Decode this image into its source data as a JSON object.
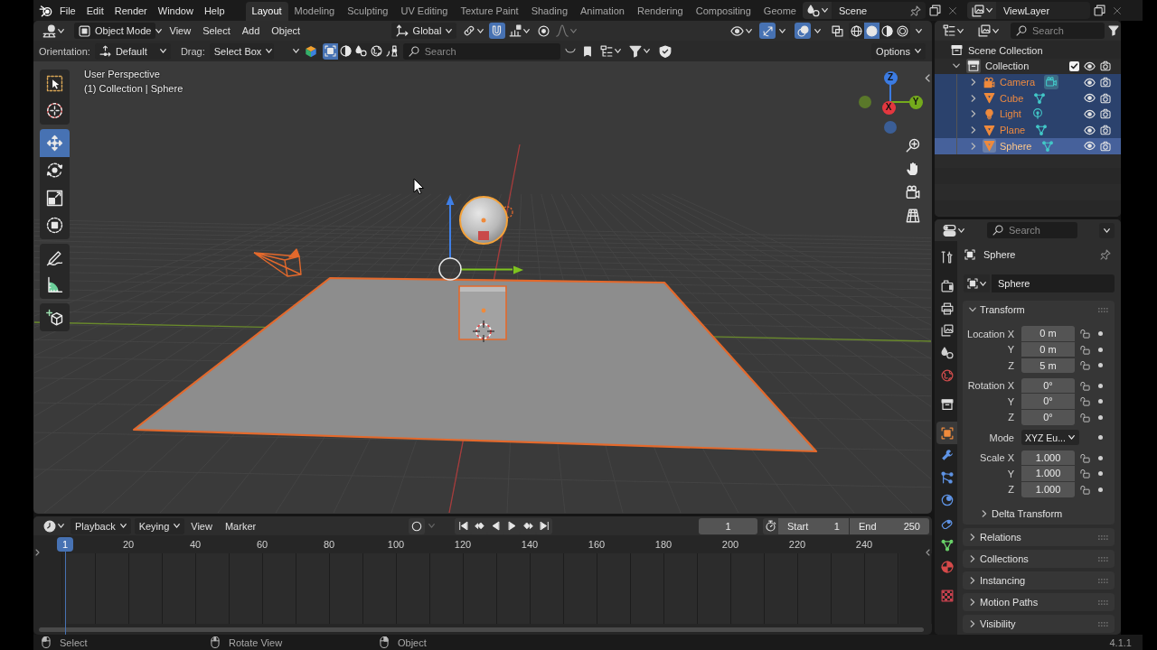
{
  "top_bar": {
    "menus": [
      "File",
      "Edit",
      "Render",
      "Window",
      "Help"
    ],
    "workspaces": [
      {
        "label": "Layout",
        "selected": true
      },
      {
        "label": "Modeling",
        "selected": false
      },
      {
        "label": "Sculpting",
        "selected": false
      },
      {
        "label": "UV Editing",
        "selected": false
      },
      {
        "label": "Texture Paint",
        "selected": false
      },
      {
        "label": "Shading",
        "selected": false
      },
      {
        "label": "Animation",
        "selected": false
      },
      {
        "label": "Rendering",
        "selected": false
      },
      {
        "label": "Compositing",
        "selected": false
      },
      {
        "label": "Geome",
        "selected": false
      }
    ],
    "scene": "Scene",
    "view_layer": "ViewLayer"
  },
  "viewport": {
    "mode": "Object Mode",
    "menus": [
      "View",
      "Select",
      "Add",
      "Object"
    ],
    "orientation": "Global",
    "snap_on": true,
    "proportional_on": false,
    "gizmos_on": true,
    "overlays_on": true,
    "xray_on": false,
    "shading": [
      {
        "kind": "wireframe",
        "selected": false
      },
      {
        "kind": "solid",
        "selected": true
      },
      {
        "kind": "material",
        "selected": false
      },
      {
        "kind": "rendered",
        "selected": false
      }
    ],
    "tool_settings": {
      "orientation_label": "Orientation:",
      "orientation": "Default",
      "drag_label": "Drag:",
      "drag": "Select Box",
      "filters": [
        {
          "kind": "object",
          "selected": true
        },
        {
          "kind": "material",
          "selected": false
        },
        {
          "kind": "scene",
          "selected": false
        },
        {
          "kind": "world",
          "selected": false
        },
        {
          "kind": "brush",
          "selected": false
        }
      ],
      "search_placeholder": "Search",
      "options": "Options"
    },
    "tools": [
      [
        {
          "kind": "select_box",
          "selected": false
        },
        {
          "kind": "cursor",
          "selected": false
        }
      ],
      [
        {
          "kind": "move",
          "selected": true
        },
        {
          "kind": "rotate",
          "selected": false
        },
        {
          "kind": "scale",
          "selected": false
        },
        {
          "kind": "transform",
          "selected": false
        }
      ],
      [
        {
          "kind": "annotate",
          "selected": false
        },
        {
          "kind": "measure",
          "selected": false
        }
      ],
      [
        {
          "kind": "add_cube",
          "selected": false
        }
      ]
    ],
    "view_name": "User Perspective",
    "view_context": "(1) Collection | Sphere",
    "axes": [
      {
        "label": "Z",
        "color": "#3b7be2"
      },
      {
        "label": "Y",
        "color": "#74aa1c"
      },
      {
        "label": "X",
        "color": "#e3373f"
      }
    ]
  },
  "outliner": {
    "search_placeholder": "Search",
    "root": "Scene Collection",
    "collections": [
      {
        "name": "Collection",
        "expanded": true,
        "active": true,
        "checked": true,
        "visible": true,
        "renderable": true,
        "children": [
          {
            "name": "Camera",
            "kind": "camera",
            "expanded": false,
            "selected": true,
            "active": false,
            "data_active": true,
            "visible": true,
            "renderable": true
          },
          {
            "name": "Cube",
            "kind": "mesh",
            "expanded": false,
            "selected": true,
            "active": false,
            "data_active": false,
            "visible": true,
            "renderable": true
          },
          {
            "name": "Light",
            "kind": "light",
            "expanded": false,
            "selected": true,
            "active": false,
            "data_active": false,
            "visible": true,
            "renderable": true
          },
          {
            "name": "Plane",
            "kind": "mesh",
            "expanded": false,
            "selected": true,
            "active": false,
            "data_active": false,
            "visible": true,
            "renderable": true
          },
          {
            "name": "Sphere",
            "kind": "mesh",
            "expanded": false,
            "selected": true,
            "active": true,
            "data_active": false,
            "visible": true,
            "renderable": true
          }
        ]
      }
    ]
  },
  "properties": {
    "search_placeholder": "Search",
    "tab_groups": [
      [
        {
          "kind": "tool",
          "selected": false
        }
      ],
      [
        {
          "kind": "render",
          "selected": false
        },
        {
          "kind": "output",
          "selected": false
        },
        {
          "kind": "view_layer",
          "selected": false
        },
        {
          "kind": "scene",
          "selected": false
        },
        {
          "kind": "world",
          "selected": false
        }
      ],
      [
        {
          "kind": "collection",
          "selected": false
        }
      ],
      [
        {
          "kind": "object",
          "selected": true
        },
        {
          "kind": "modifiers",
          "selected": false
        },
        {
          "kind": "particles",
          "selected": false
        },
        {
          "kind": "physics",
          "selected": false
        },
        {
          "kind": "constraints",
          "selected": false
        },
        {
          "kind": "data",
          "selected": false
        },
        {
          "kind": "material",
          "selected": false
        }
      ],
      [
        {
          "kind": "texture",
          "selected": false
        }
      ]
    ],
    "context": "Sphere",
    "name": "Sphere",
    "panels": [
      {
        "title": "Transform",
        "expanded": true,
        "groups": [
          [
            {
              "kind": "number",
              "label": "Location X",
              "value": "0 m",
              "locked": false
            },
            {
              "kind": "number",
              "label": "Y",
              "value": "0 m",
              "locked": false
            },
            {
              "kind": "number",
              "label": "Z",
              "value": "5 m",
              "locked": false
            }
          ],
          [
            {
              "kind": "number",
              "label": "Rotation X",
              "value": "0°",
              "locked": false
            },
            {
              "kind": "number",
              "label": "Y",
              "value": "0°",
              "locked": false
            },
            {
              "kind": "number",
              "label": "Z",
              "value": "0°",
              "locked": false
            }
          ],
          [
            {
              "kind": "dropdown",
              "label": "Mode",
              "value": "XYZ Eu..."
            }
          ],
          [
            {
              "kind": "number",
              "label": "Scale X",
              "value": "1.000",
              "locked": false
            },
            {
              "kind": "number",
              "label": "Y",
              "value": "1.000",
              "locked": false
            },
            {
              "kind": "number",
              "label": "Z",
              "value": "1.000",
              "locked": false
            }
          ]
        ],
        "subpanels": [
          {
            "title": "Delta Transform",
            "expanded": false
          }
        ]
      },
      {
        "title": "Relations",
        "expanded": false
      },
      {
        "title": "Collections",
        "expanded": false
      },
      {
        "title": "Instancing",
        "expanded": false
      },
      {
        "title": "Motion Paths",
        "expanded": false
      },
      {
        "title": "Visibility",
        "expanded": false
      }
    ]
  },
  "timeline": {
    "menus": [
      {
        "label": "Playback",
        "kind": "dropdown"
      },
      {
        "label": "Keying",
        "kind": "dropdown"
      },
      {
        "label": "View",
        "kind": "menu"
      },
      {
        "label": "Marker",
        "kind": "menu"
      }
    ],
    "auto_key_on": false,
    "current_frame": "1",
    "start_label": "Start",
    "start": "1",
    "end_label": "End",
    "end": "250",
    "playhead": "1",
    "ruler": [
      "20",
      "40",
      "60",
      "80",
      "100",
      "120",
      "140",
      "160",
      "180",
      "200",
      "220",
      "240"
    ]
  },
  "status_bar": {
    "hints": [
      {
        "kind": "left",
        "text": "Select"
      },
      {
        "kind": "middle",
        "text": "Rotate View"
      },
      {
        "kind": "right",
        "text": "Object"
      }
    ],
    "version": "4.1.1"
  }
}
